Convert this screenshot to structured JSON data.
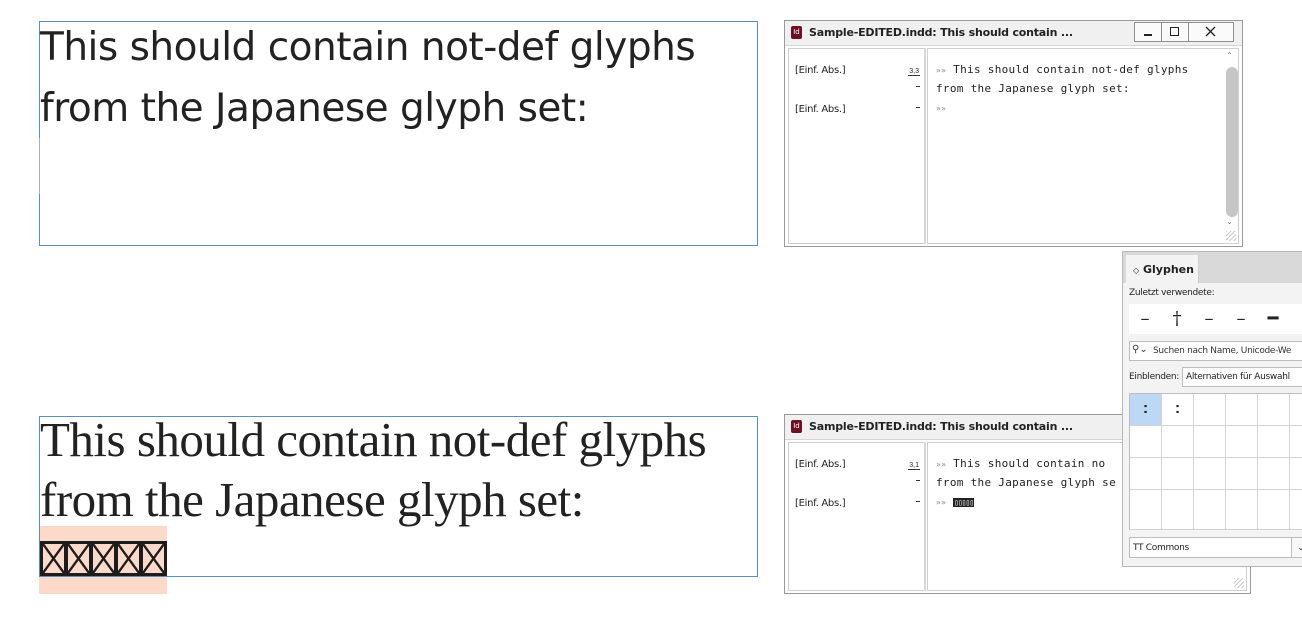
{
  "top_frame": {
    "line1": "This should contain not-def glyphs",
    "line2": "from the Japanese glyph set:"
  },
  "bottom_frame": {
    "line1": "This should contain not-def glyphs",
    "line2": "from the Japanese glyph set:",
    "notdef_count": 5
  },
  "story_editor_top": {
    "title": "Sample-EDITED.indd: This should contain ...",
    "para1_tag": "[Einf. Abs.]",
    "para1_depth": "3,3",
    "para2_tag": "[Einf. Abs.]",
    "line1": "This should contain not-def glyphs",
    "line2": "from the Japanese glyph set:",
    "pilcrow": "»»"
  },
  "story_editor_bottom": {
    "title": "Sample-EDITED.indd: This should contain ...",
    "para1_tag": "[Einf. Abs.]",
    "para1_depth": "3,1",
    "para2_tag": "[Einf. Abs.]",
    "line1": "This should contain no",
    "line2": "from the Japanese glyph se",
    "pilcrow": "»»",
    "boxes": "▯▯▯▯▯"
  },
  "glyph_panel": {
    "tab": "Glyphen",
    "recent_label": "Zuletzt verwendete:",
    "recent_glyphs": [
      "–",
      "†",
      "–",
      "–",
      "━",
      "›"
    ],
    "search_placeholder": "Suchen nach Name, Unicode-We",
    "show_label": "Einblenden:",
    "show_value": "Alternativen für Auswahl",
    "grid_glyphs": [
      ":",
      ":"
    ],
    "font": "TT Commons"
  }
}
